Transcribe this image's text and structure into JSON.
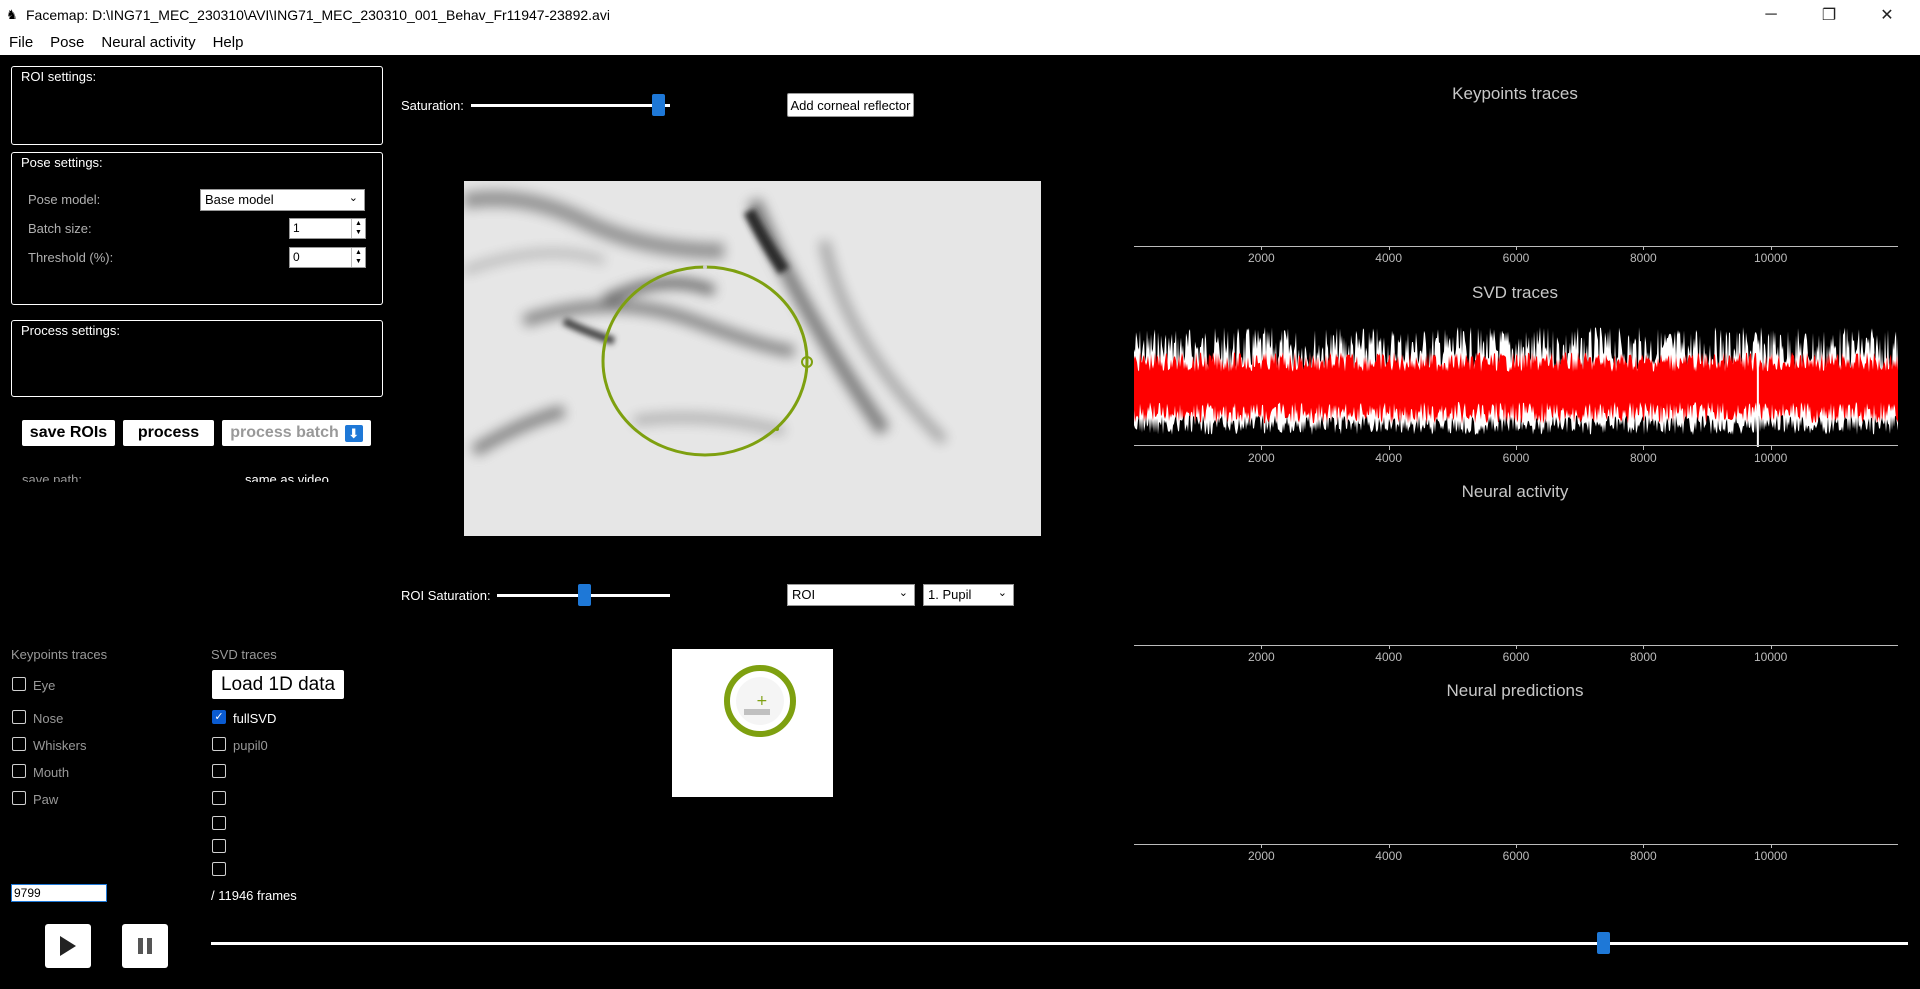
{
  "window": {
    "title": "Facemap: D:\\ING71_MEC_230310\\AVI\\ING71_MEC_230310_001_Behav_Fr11947-23892.avi",
    "minimize": "─",
    "restore": "❐",
    "close": "✕"
  },
  "menu": [
    "File",
    "Pose",
    "Neural activity",
    "Help"
  ],
  "roi_settings": {
    "title": "ROI settings:"
  },
  "pose_settings": {
    "title": "Pose settings:",
    "pose_model_label": "Pose model:",
    "pose_model_value": "Base model",
    "batch_size_label": "Batch size:",
    "batch_size_value": "1",
    "threshold_label": "Threshold (%):",
    "threshold_value": "0"
  },
  "process_settings": {
    "title": "Process settings:"
  },
  "buttons": {
    "save_rois": "save ROIs",
    "process": "process",
    "process_batch": "process batch",
    "add_corneal": "Add corneal reflector",
    "load_1d": "Load 1D data"
  },
  "save_path": {
    "label": "save path:",
    "value": "same as video"
  },
  "saturation": {
    "label": "Saturation:",
    "value": 0.94
  },
  "roi_saturation": {
    "label": "ROI Saturation:",
    "value": 0.5
  },
  "roi_dropdown": {
    "value": "ROI"
  },
  "roi_select": {
    "value": "1. Pupil"
  },
  "keypoints": {
    "title": "Keypoints traces",
    "items": [
      "Eye",
      "Nose",
      "Whiskers",
      "Mouth",
      "Paw"
    ]
  },
  "svd": {
    "title": "SVD traces",
    "items": [
      {
        "label": "fullSVD",
        "checked": true
      },
      {
        "label": "pupil0",
        "checked": false
      },
      {
        "label": "",
        "checked": false
      },
      {
        "label": "",
        "checked": false
      },
      {
        "label": "",
        "checked": false
      },
      {
        "label": "",
        "checked": false
      },
      {
        "label": "",
        "checked": false
      }
    ]
  },
  "frame": {
    "current": "9799",
    "total_label": "/ 11946 frames",
    "position": 0.82
  },
  "player": {
    "play_icon": "play-icon",
    "pause_icon": "pause-icon"
  },
  "panels": {
    "keypoints_title": "Keypoints traces",
    "svd_title": "SVD traces",
    "neural_title": "Neural activity",
    "predictions_title": "Neural predictions",
    "ticks": [
      "2000",
      "4000",
      "6000",
      "8000",
      "10000"
    ]
  },
  "colors": {
    "accent": "#1e78d7",
    "roi_ring": "#7ea010",
    "svd_red": "#ff0000"
  }
}
